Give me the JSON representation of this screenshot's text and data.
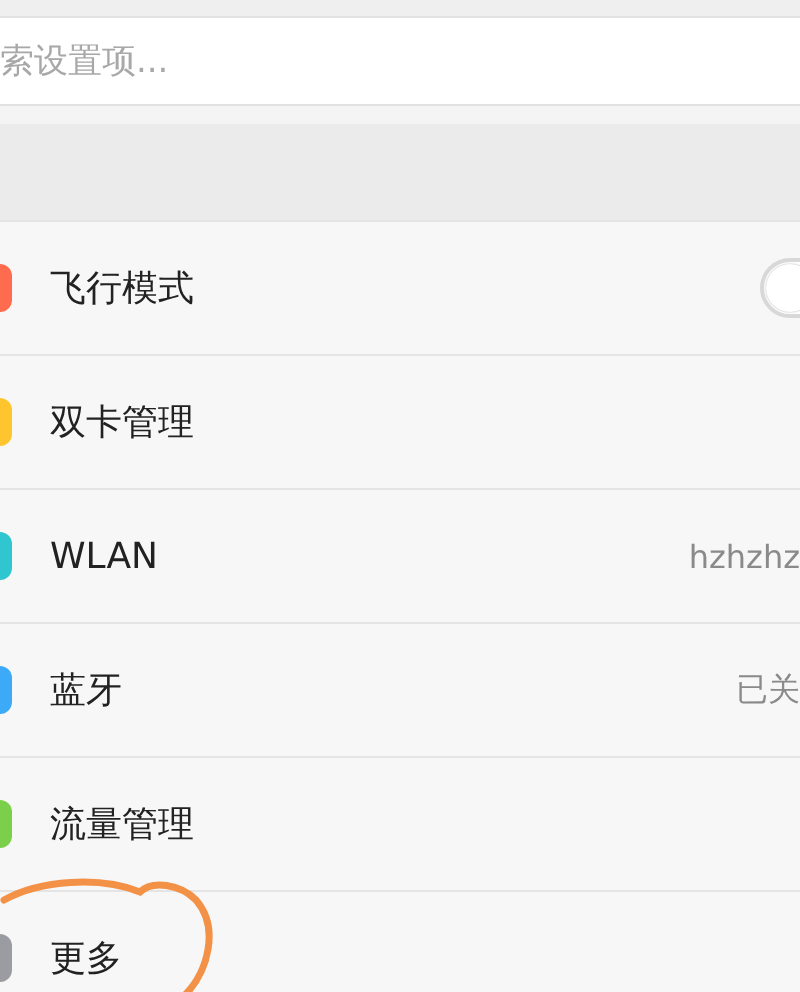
{
  "search": {
    "placeholder": "索设置项..."
  },
  "settings": [
    {
      "label": "飞行模式",
      "color": "#ff6b4f",
      "kind": "toggle",
      "on": false
    },
    {
      "label": "双卡管理",
      "color": "#ffc52e",
      "kind": "link"
    },
    {
      "label": "WLAN",
      "color": "#2fc6cf",
      "kind": "value",
      "value": "hzhzhz"
    },
    {
      "label": "蓝牙",
      "color": "#3daaf7",
      "kind": "value",
      "value": "已关"
    },
    {
      "label": "流量管理",
      "color": "#7ccf4a",
      "kind": "link"
    },
    {
      "label": "更多",
      "color": "#9b9ba2",
      "kind": "link"
    }
  ]
}
